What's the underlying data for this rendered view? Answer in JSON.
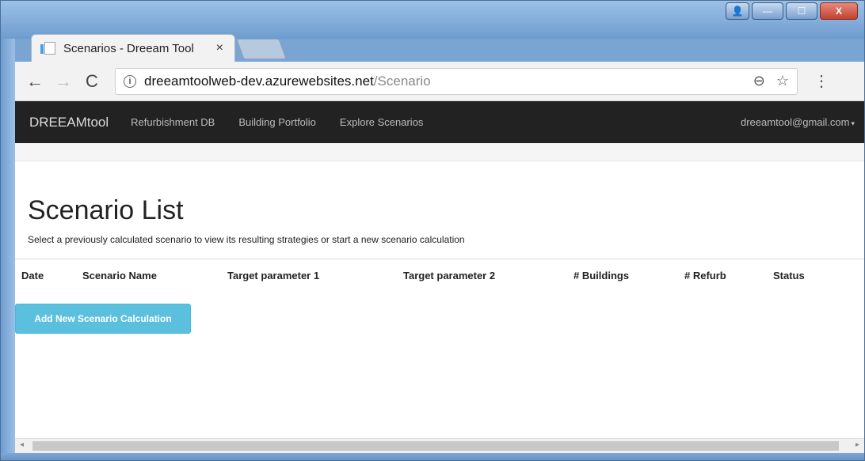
{
  "window": {
    "controls": {
      "user": "👤",
      "minimize": "—",
      "maximize": "☐",
      "close": "X"
    }
  },
  "tab": {
    "title": "Scenarios - Dreeam Tool",
    "close": "×"
  },
  "toolbar": {
    "back": "←",
    "forward": "→",
    "reload": "C",
    "url_host": "dreeamtoolweb-dev.azurewebsites.net",
    "url_path": "/Scenario",
    "info": "i",
    "zoom_icon": "⊖",
    "star_icon": "☆",
    "menu_icon": "⋮"
  },
  "navbar": {
    "brand": "DREEAMtool",
    "links": [
      "Refurbishment DB",
      "Building Portfolio",
      "Explore Scenarios"
    ],
    "user": "dreeamtool@gmail.com",
    "caret": "▾"
  },
  "main": {
    "title": "Scenario List",
    "subtitle": "Select a previously calculated scenario to view its resulting strategies or start a new scenario calculation",
    "columns": [
      "Date",
      "Scenario Name",
      "Target parameter 1",
      "Target parameter 2",
      "# Buildings",
      "# Refurb",
      "Status"
    ],
    "add_button": "Add New Scenario Calculation"
  },
  "scrollbar": {
    "left": "◂",
    "right": "▸"
  }
}
